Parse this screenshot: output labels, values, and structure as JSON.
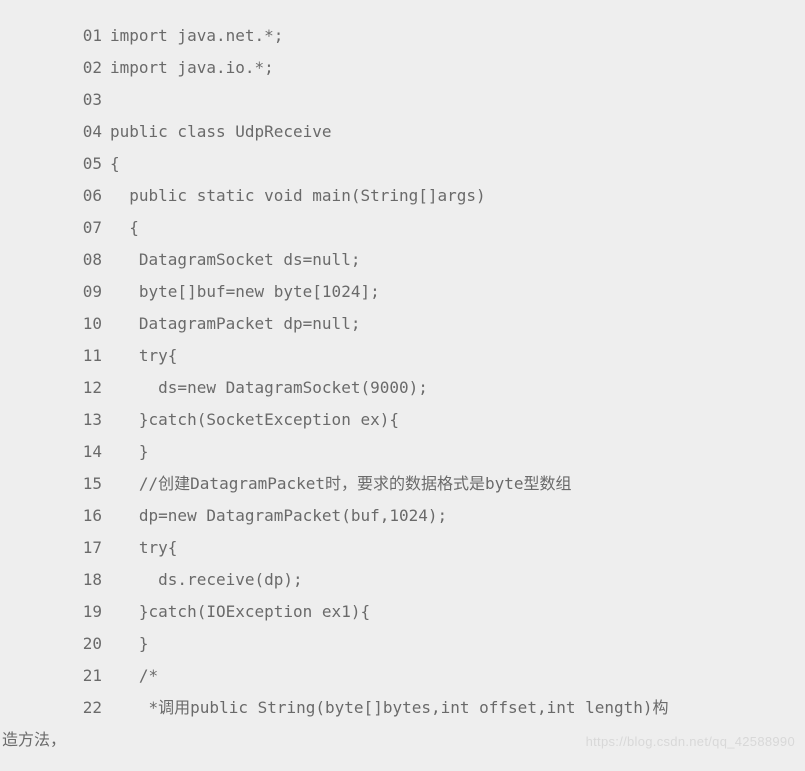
{
  "code": {
    "lines": [
      {
        "num": "01",
        "text": "import java.net.*;"
      },
      {
        "num": "02",
        "text": "import java.io.*;"
      },
      {
        "num": "03",
        "text": ""
      },
      {
        "num": "04",
        "text": "public class UdpReceive"
      },
      {
        "num": "05",
        "text": "{"
      },
      {
        "num": "06",
        "text": "  public static void main(String[]args)"
      },
      {
        "num": "07",
        "text": "  {"
      },
      {
        "num": "08",
        "text": "   DatagramSocket ds=null;"
      },
      {
        "num": "09",
        "text": "   byte[]buf=new byte[1024];"
      },
      {
        "num": "10",
        "text": "   DatagramPacket dp=null;"
      },
      {
        "num": "11",
        "text": "   try{"
      },
      {
        "num": "12",
        "text": "     ds=new DatagramSocket(9000);"
      },
      {
        "num": "13",
        "text": "   }catch(SocketException ex){"
      },
      {
        "num": "14",
        "text": "   }"
      },
      {
        "num": "15",
        "text": "   //创建DatagramPacket时，要求的数据格式是byte型数组"
      },
      {
        "num": "16",
        "text": "   dp=new DatagramPacket(buf,1024);"
      },
      {
        "num": "17",
        "text": "   try{"
      },
      {
        "num": "18",
        "text": "     ds.receive(dp);"
      },
      {
        "num": "19",
        "text": "   }catch(IOException ex1){"
      },
      {
        "num": "20",
        "text": "   }"
      },
      {
        "num": "21",
        "text": "   /*"
      },
      {
        "num": "22",
        "text": "    *调用public String(byte[]bytes,int offset,int length)构"
      }
    ],
    "wrap_text": "造方法，"
  },
  "watermark": "https://blog.csdn.net/qq_42588990"
}
